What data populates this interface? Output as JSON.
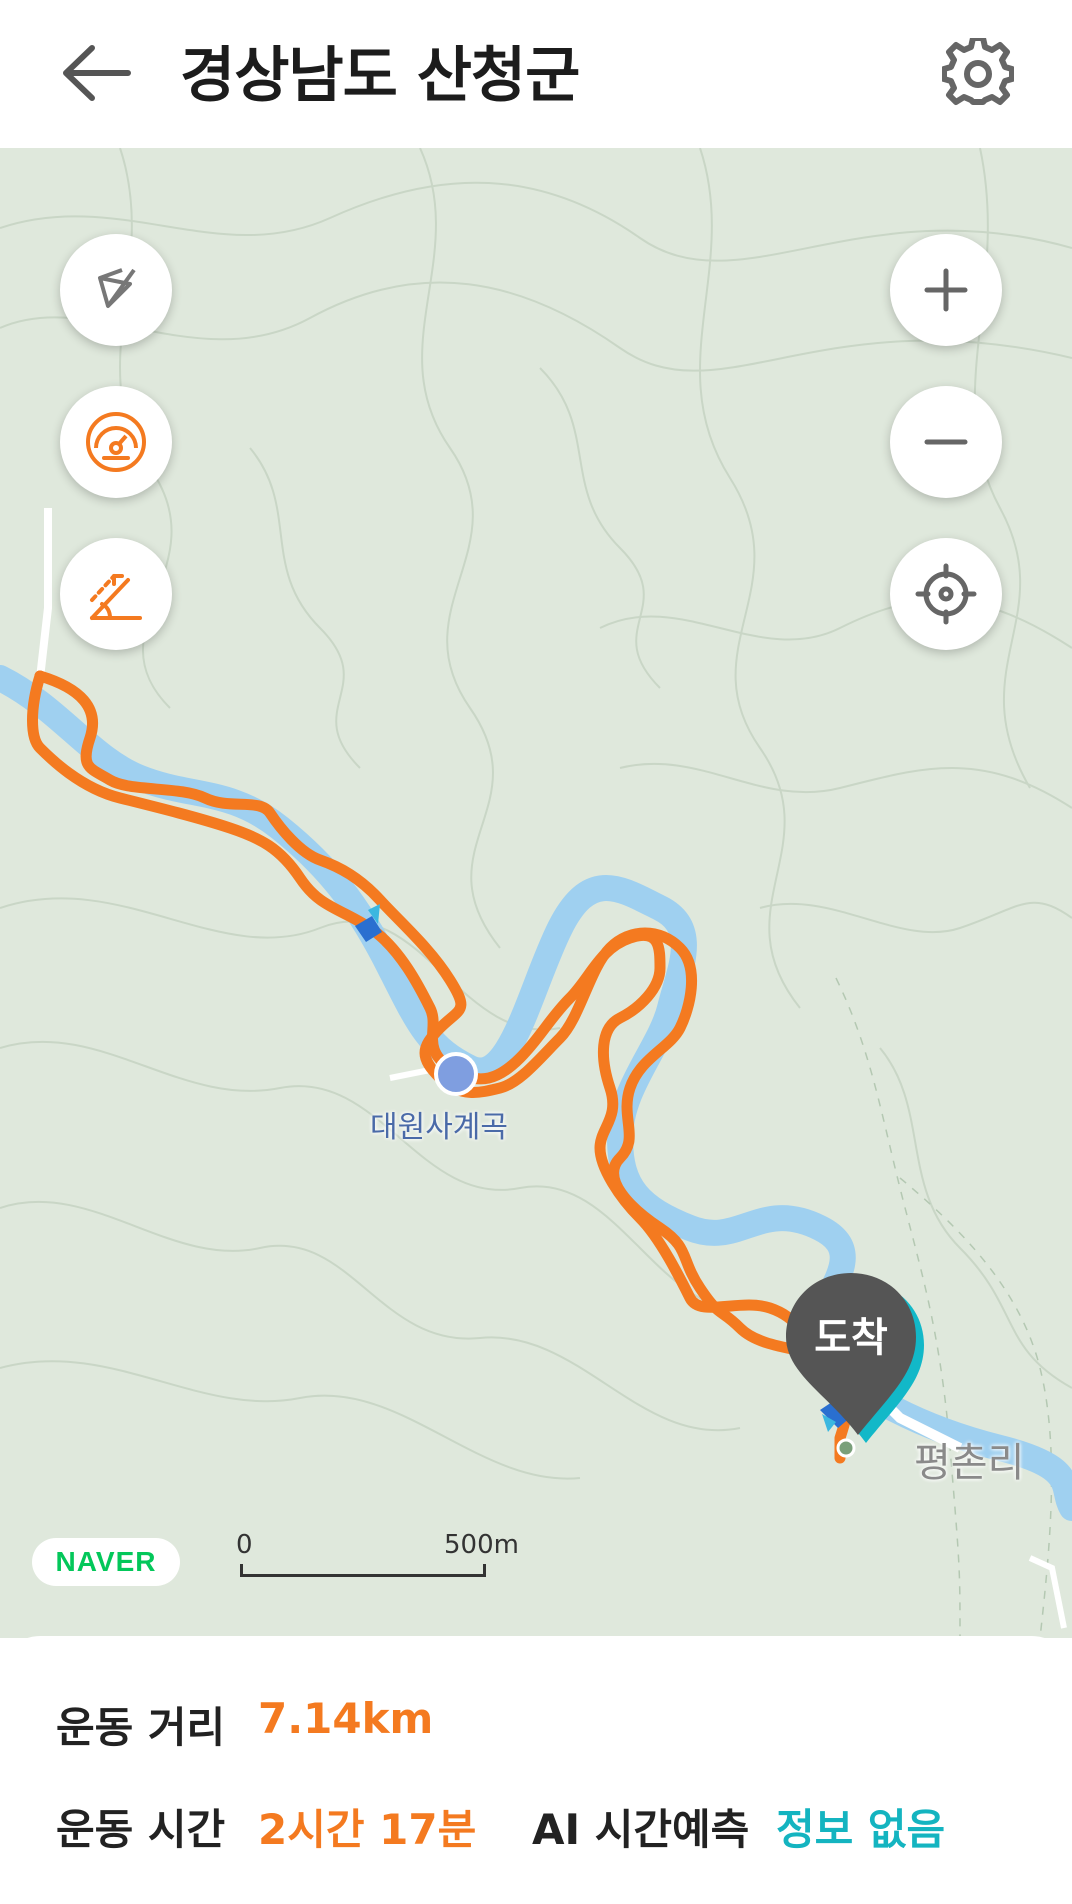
{
  "header": {
    "title": "경상남도 산청군",
    "back_icon": "arrow-left-icon",
    "settings_icon": "gear-icon"
  },
  "map": {
    "left_controls": [
      {
        "icon": "compass-off-icon"
      },
      {
        "icon": "speedometer-icon"
      },
      {
        "icon": "slope-angle-icon"
      }
    ],
    "right_controls": [
      {
        "icon": "zoom-in-icon"
      },
      {
        "icon": "zoom-out-icon"
      },
      {
        "icon": "crosshair-location-icon"
      }
    ],
    "labels": {
      "valley": "대원사계곡",
      "village": "평촌리"
    },
    "arrival_marker": "도착",
    "provider": "NAVER",
    "scale": {
      "start": "0",
      "end": "500m"
    },
    "colors": {
      "route": "#f47a20",
      "river": "#9fd0f0",
      "map_bg": "#dfe8dc"
    }
  },
  "stats": {
    "distance_label": "운동 거리",
    "distance_value": "7.14km",
    "time_label": "운동 시간",
    "time_value": "2시간 17분",
    "ai_label": "AI 시간예측",
    "ai_value": "정보 없음",
    "colors": {
      "accent_orange": "#f47a20",
      "accent_teal": "#14b4c0"
    }
  }
}
